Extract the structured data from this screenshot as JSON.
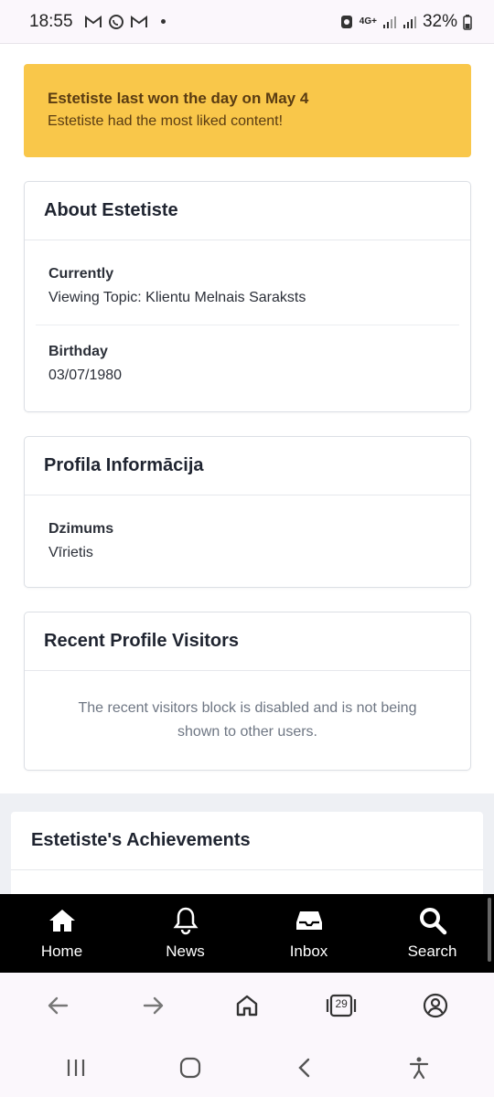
{
  "status_bar": {
    "time": "18:55",
    "battery": "32%",
    "network": "4G+",
    "left_icons": [
      "gmail-icon",
      "whatsapp-icon",
      "gmail-icon"
    ],
    "right_icons": [
      "battery-saver-icon",
      "signal-icon",
      "signal-icon",
      "battery-icon"
    ]
  },
  "banner": {
    "title": "Estetiste last won the day on May 4",
    "text": "Estetiste had the most liked content!"
  },
  "about": {
    "title": "About Estetiste",
    "fields": [
      {
        "label": "Currently",
        "value": "Viewing Topic: Klientu Melnais Saraksts"
      },
      {
        "label": "Birthday",
        "value": "03/07/1980"
      }
    ]
  },
  "profile_info": {
    "title": "Profila Informācija",
    "fields": [
      {
        "label": "Dzimums",
        "value": "Vīrietis"
      }
    ]
  },
  "visitors": {
    "title": "Recent Profile Visitors",
    "note": "The recent visitors block is disabled and is not being shown to other users."
  },
  "achievements": {
    "title": "Estetiste's Achievements"
  },
  "app_nav": {
    "items": [
      {
        "label": "Home",
        "icon": "home-icon"
      },
      {
        "label": "News",
        "icon": "bell-icon"
      },
      {
        "label": "Inbox",
        "icon": "inbox-icon"
      },
      {
        "label": "Search",
        "icon": "search-icon"
      }
    ]
  },
  "browser_bar": {
    "tab_count": "29",
    "icons": [
      "back-arrow-icon",
      "forward-arrow-icon",
      "home-outline-icon",
      "tabs-icon",
      "account-icon"
    ]
  },
  "system_nav": {
    "icons": [
      "recents-icon",
      "home-circle-icon",
      "back-icon",
      "accessibility-icon"
    ]
  },
  "colors": {
    "banner_bg": "#f9c74a",
    "banner_text": "#5a3c12",
    "nav_bg": "#000000",
    "muted_text": "#6e7683"
  }
}
